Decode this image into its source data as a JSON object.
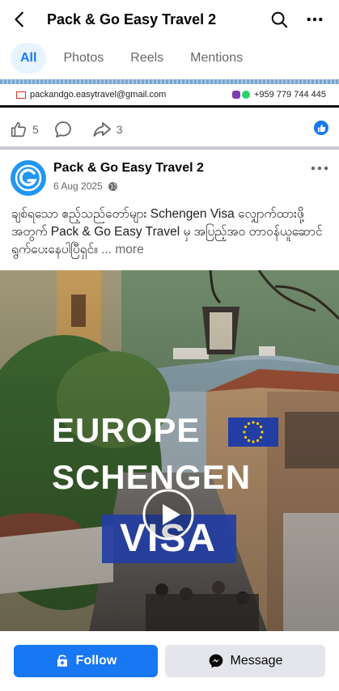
{
  "header": {
    "title": "Pack & Go Easy Travel 2",
    "back_icon": "arrow-left-icon",
    "search_icon": "search-icon",
    "more_icon": "more-horizontal-icon"
  },
  "tabs": [
    {
      "label": "All",
      "active": true
    },
    {
      "label": "Photos",
      "active": false
    },
    {
      "label": "Reels",
      "active": false
    },
    {
      "label": "Mentions",
      "active": false
    }
  ],
  "banner": {
    "email": "packandgo.easytravel@gmail.com",
    "phone": "+959 779 744 445"
  },
  "reactions": {
    "likes": "5",
    "shares": "3"
  },
  "post": {
    "page_name": "Pack & Go Easy Travel 2",
    "date": "6 Aug 2025",
    "text": "ချစ်ရသော ဧည့်သည်တော်များ Schengen Visa လျှောက်ထားဖို့အတွက် Pack & Go Easy Travel မှ အပြည့်အဝ တာဝန်ယူဆောင်ရွက်ပေးနေပါပြီရှင်။",
    "more_label": "... more",
    "media": {
      "line1": "EUROPE",
      "line2": "SCHENGEN",
      "line3": "VISA"
    }
  },
  "actions": {
    "follow": "Follow",
    "message": "Message"
  },
  "colors": {
    "brand_blue": "#1877f2",
    "tab_active_bg": "#e7f3ff",
    "secondary_button": "#e4e6eb",
    "visa_box": "#233ea3"
  }
}
